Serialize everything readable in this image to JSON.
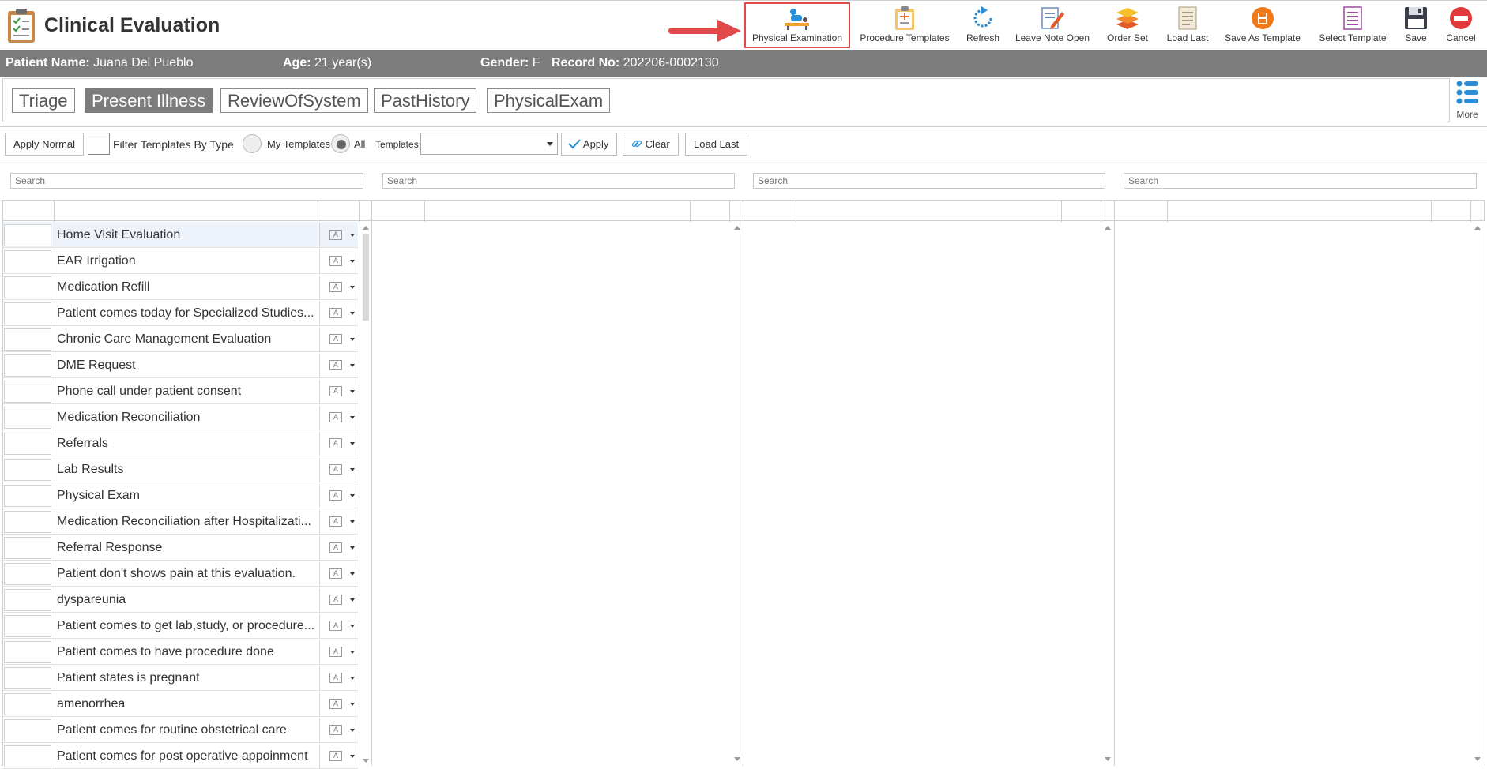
{
  "app": {
    "title": "Clinical Evaluation"
  },
  "toolbar": [
    {
      "label": "Physical Examination",
      "icon": "physical-exam-icon"
    },
    {
      "label": "Procedure Templates",
      "icon": "clipboard-icon"
    },
    {
      "label": "Refresh",
      "icon": "refresh-icon"
    },
    {
      "label": "Leave Note Open",
      "icon": "note-edit-icon"
    },
    {
      "label": "Order Set",
      "icon": "layers-icon"
    },
    {
      "label": "Load Last",
      "icon": "document-icon"
    },
    {
      "label": "Save As Template",
      "icon": "save-as-icon"
    },
    {
      "label": "Select Template",
      "icon": "template-list-icon"
    },
    {
      "label": "Save",
      "icon": "floppy-icon"
    },
    {
      "label": "Cancel",
      "icon": "cancel-icon"
    }
  ],
  "patient": {
    "name_label": "Patient Name:",
    "name": "Juana Del Pueblo",
    "age_label": "Age:",
    "age": "21 year(s)",
    "gender_label": "Gender:",
    "gender": "F",
    "record_label": "Record No:",
    "record": "202206-0002130"
  },
  "tabs": [
    "Triage",
    "Present Illness",
    "ReviewOfSystem",
    "PastHistory",
    "PhysicalExam"
  ],
  "active_tab": "Present Illness",
  "more_label": "More",
  "controls": {
    "apply_normal": "Apply Normal",
    "filter_label": "Filter Templates By Type",
    "my_templates": "My Templates",
    "all": "All",
    "templates_label": "Templates:",
    "templates_value": "",
    "apply": "Apply",
    "clear": "Clear",
    "load_last": "Load Last"
  },
  "search_placeholder": "Search",
  "templates": [
    "Home Visit Evaluation",
    "EAR Irrigation",
    "Medication Refill",
    "Patient comes today for Specialized Studies...",
    "Chronic Care Management Evaluation",
    "DME Request",
    "Phone call under patient consent",
    "Medication Reconciliation",
    "Referrals",
    "Lab Results",
    "Physical Exam",
    "Medication Reconciliation after Hospitalizati...",
    "Referral Response",
    "Patient don't shows pain at this evaluation.",
    "dyspareunia",
    "Patient comes to get lab,study, or procedure...",
    "Patient comes to have procedure done",
    "Patient states is pregnant",
    "amenorrhea",
    "Patient comes for routine obstetrical care",
    "Patient comes for post operative appoinment"
  ],
  "colors": {
    "header_gray": "#7c7c7c",
    "highlight_red": "#e04a4a",
    "accent_blue": "#2a8fd6"
  }
}
